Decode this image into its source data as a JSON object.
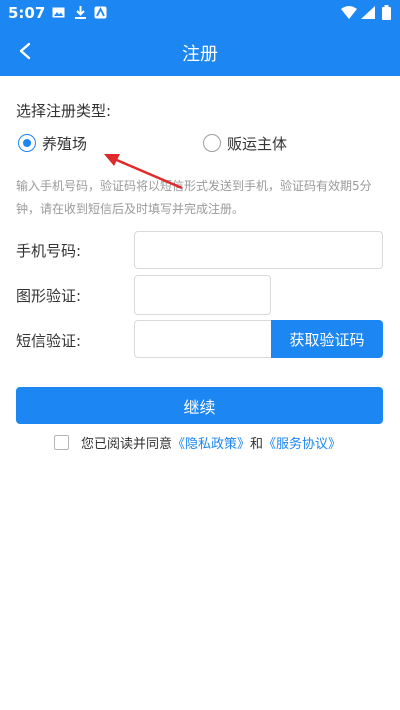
{
  "statusbar": {
    "time": "5:07"
  },
  "appbar": {
    "title": "注册"
  },
  "form": {
    "section_title": "选择注册类型:",
    "type_options": [
      "养殖场",
      "贩运主体"
    ],
    "hint": "输入手机号码，验证码将以短信形式发送到手机，验证码有效期5分钟，请在收到短信后及时填写并完成注册。",
    "phone_label": "手机号码:",
    "captcha_label": "图形验证:",
    "sms_label": "短信验证:",
    "get_code_label": "获取验证码",
    "continue_label": "继续"
  },
  "agreement": {
    "prefix": "您已阅读并同意",
    "privacy": "《隐私政策》",
    "and": "和",
    "service": "《服务协议》"
  },
  "colors": {
    "primary": "#1c86f2",
    "annotation_arrow": "#e02a2a"
  }
}
